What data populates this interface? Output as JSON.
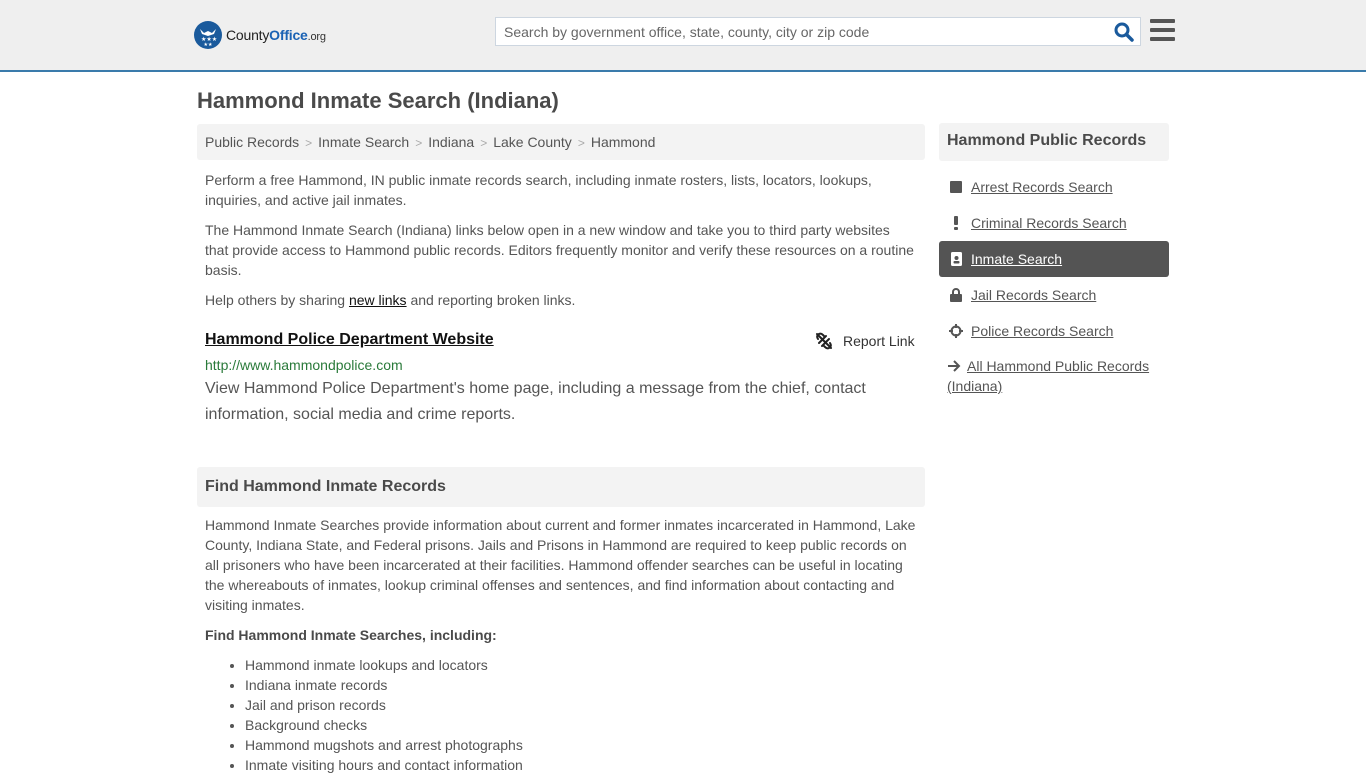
{
  "header": {
    "logo": {
      "name_part1": "County",
      "name_part2": "Office",
      "suffix": ".org"
    },
    "search_placeholder": "Search by government office, state, county, city or zip code",
    "colors": {
      "brand_blue": "#1a5a9c",
      "header_border": "#3a7bab"
    }
  },
  "page_title": "Hammond Inmate Search (Indiana)",
  "breadcrumb": [
    "Public Records",
    "Inmate Search",
    "Indiana",
    "Lake County",
    "Hammond"
  ],
  "breadcrumb_sep": ">",
  "intro": {
    "p1": "Perform a free Hammond, IN public inmate records search, including inmate rosters, lists, locators, lookups, inquiries, and active jail inmates.",
    "p2": "The Hammond Inmate Search (Indiana) links below open in a new window and take you to third party websites that provide access to Hammond public records. Editors frequently monitor and verify these resources on a routine basis.",
    "p3_before": "Help others by sharing ",
    "p3_link": "new links",
    "p3_after": " and reporting broken links."
  },
  "result": {
    "title": "Hammond Police Department Website",
    "report_label": "Report Link",
    "url": "http://www.hammondpolice.com",
    "description": "View Hammond Police Department's home page, including a message from the chief, contact information, social media and crime reports."
  },
  "find_section": {
    "heading": "Find Hammond Inmate Records",
    "body": "Hammond Inmate Searches provide information about current and former inmates incarcerated in Hammond, Lake County, Indiana State, and Federal prisons. Jails and Prisons in Hammond are required to keep public records on all prisoners who have been incarcerated at their facilities. Hammond offender searches can be useful in locating the whereabouts of inmates, lookup criminal offenses and sentences, and find information about contacting and visiting inmates.",
    "sub_heading": "Find Hammond Inmate Searches, including:",
    "bullets": [
      "Hammond inmate lookups and locators",
      "Indiana inmate records",
      "Jail and prison records",
      "Background checks",
      "Hammond mugshots and arrest photographs",
      "Inmate visiting hours and contact information"
    ]
  },
  "sidebar": {
    "heading": "Hammond Public Records",
    "items": [
      {
        "label": "Arrest Records Search",
        "icon": "square-icon",
        "active": false
      },
      {
        "label": "Criminal Records Search",
        "icon": "exclamation-icon",
        "active": false
      },
      {
        "label": "Inmate Search",
        "icon": "id-badge-icon",
        "active": true
      },
      {
        "label": "Jail Records Search",
        "icon": "lock-icon",
        "active": false
      },
      {
        "label": "Police Records Search",
        "icon": "crosshair-icon",
        "active": false
      }
    ],
    "all_link": "All Hammond Public Records (Indiana)"
  }
}
